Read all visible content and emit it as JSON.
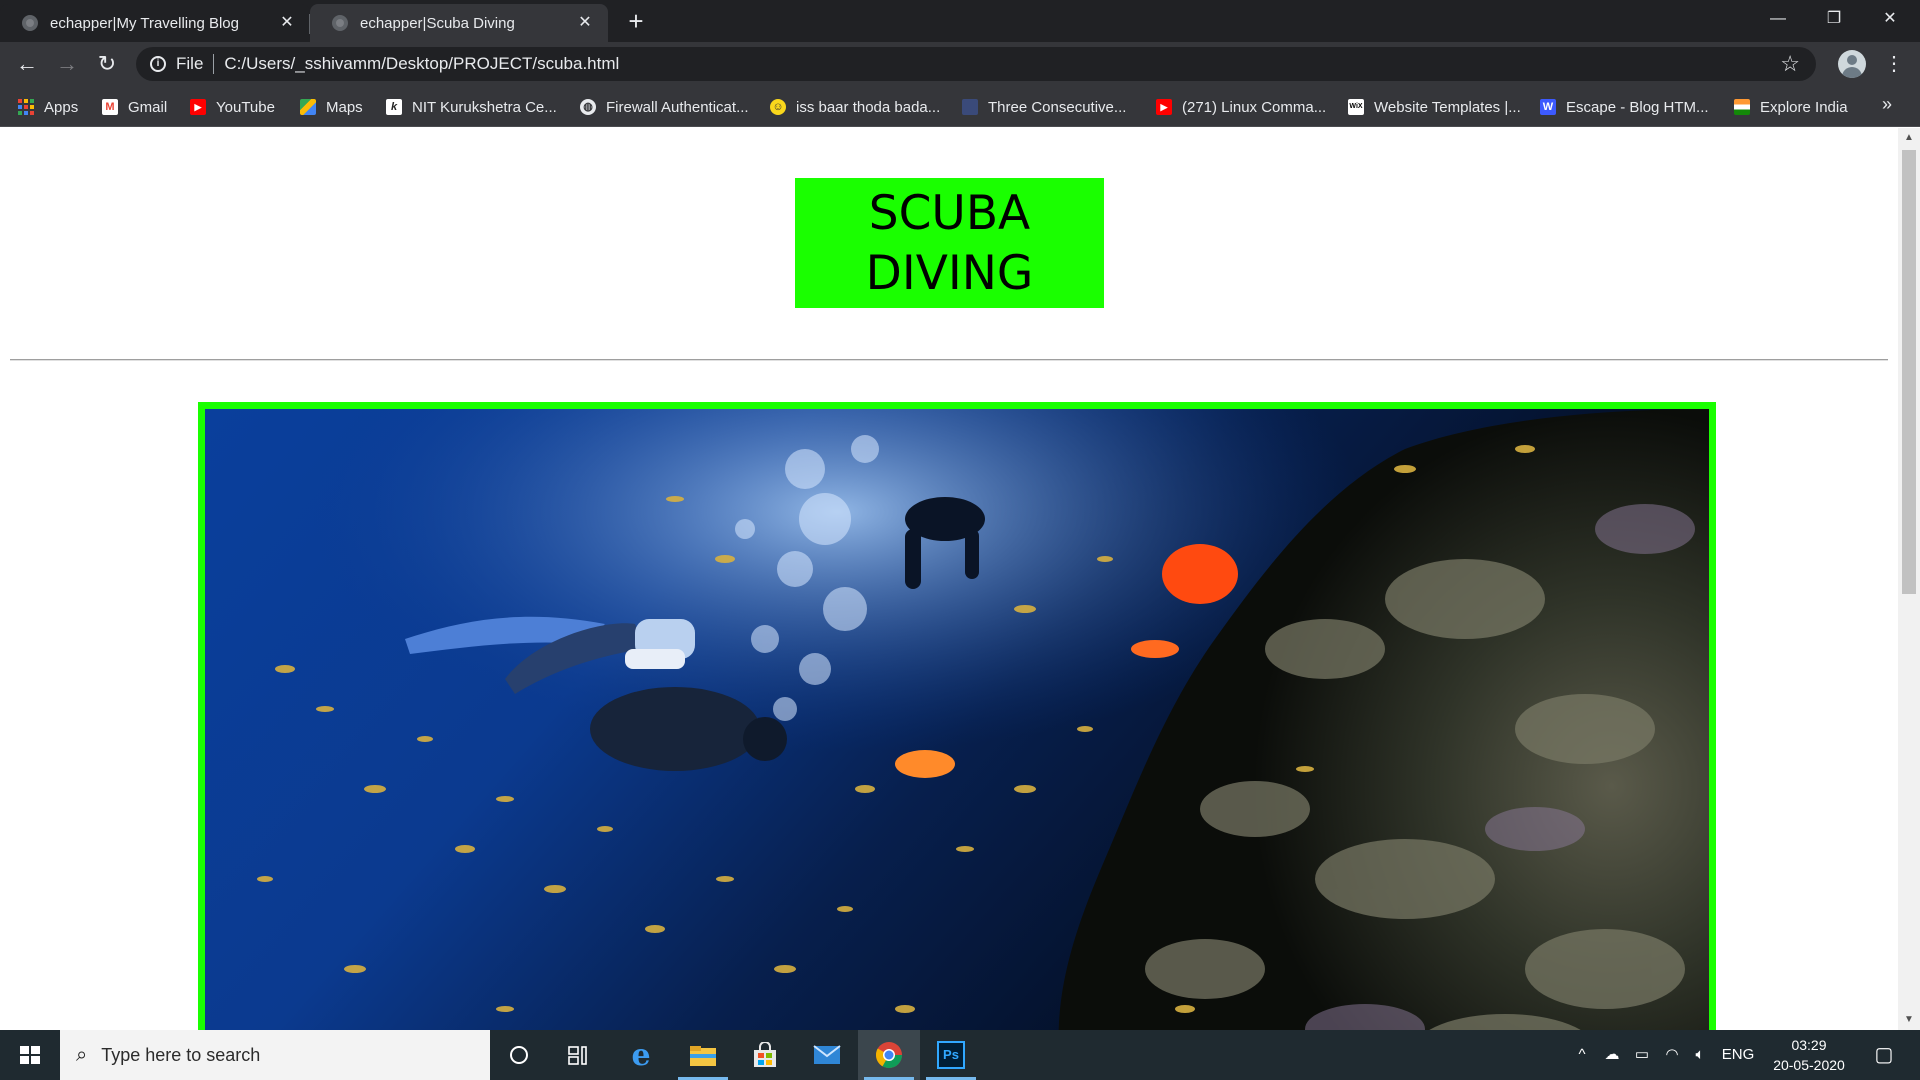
{
  "browser": {
    "tabs": [
      {
        "title": "echapper|My Travelling Blog",
        "active": false
      },
      {
        "title": "echapper|Scuba Diving",
        "active": true
      }
    ],
    "address": {
      "scheme": "File",
      "url": "C:/Users/_sshivamm/Desktop/PROJECT/scuba.html"
    },
    "bookmarks": [
      {
        "label": "Apps",
        "icon": "apps-grid-icon"
      },
      {
        "label": "Gmail",
        "icon": "gmail-icon"
      },
      {
        "label": "YouTube",
        "icon": "youtube-icon"
      },
      {
        "label": "Maps",
        "icon": "maps-icon"
      },
      {
        "label": "NIT Kurukshetra Ce...",
        "icon": "nit-kurukshetra-icon"
      },
      {
        "label": "Firewall Authenticat...",
        "icon": "globe-icon"
      },
      {
        "label": "iss baar thoda bada...",
        "icon": "smiley-icon"
      },
      {
        "label": "Three Consecutive...",
        "icon": "site-icon"
      },
      {
        "label": "(271) Linux Comma...",
        "icon": "youtube-icon"
      },
      {
        "label": "Website Templates |...",
        "icon": "wix-icon"
      },
      {
        "label": "Escape - Blog HTM...",
        "icon": "w-icon"
      },
      {
        "label": "Explore India",
        "icon": "india-flag-icon"
      }
    ]
  },
  "page": {
    "title_line1": "SCUBA",
    "title_line2": "DIVING",
    "accent_color": "#1aff00"
  },
  "taskbar": {
    "search_placeholder": "Type here to search",
    "language": "ENG",
    "time": "03:29",
    "date": "20-05-2020"
  }
}
